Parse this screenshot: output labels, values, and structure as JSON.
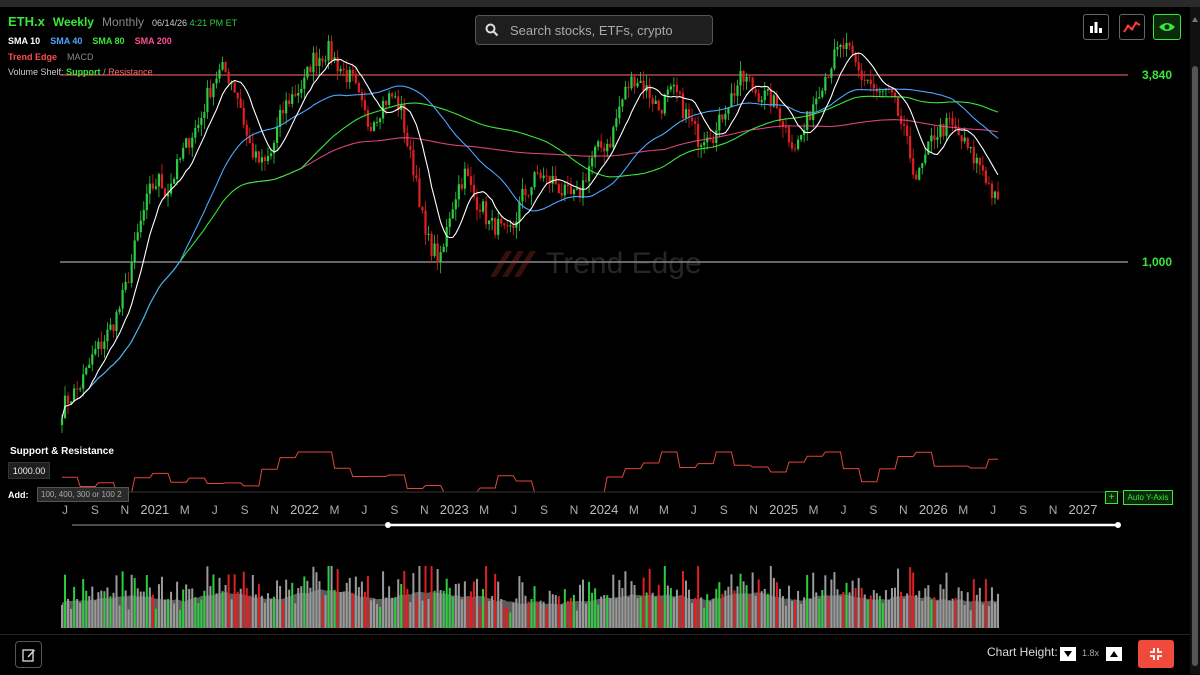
{
  "header": {
    "symbol": "ETH.x",
    "timeframes": [
      "Weekly",
      "Monthly"
    ],
    "active_timeframe": "Weekly",
    "date": "06/14/26",
    "time": "4:21 PM ET"
  },
  "indicators": [
    {
      "label": "SMA 10",
      "color": "#ffffff"
    },
    {
      "label": "SMA 40",
      "color": "#4da6ff"
    },
    {
      "label": "SMA 80",
      "color": "#39e639"
    },
    {
      "label": "SMA 200",
      "color": "#ff4d94"
    }
  ],
  "row2": {
    "trend_edge": "Trend Edge",
    "macd": "MACD"
  },
  "volume_shelf": {
    "label": "Volume Shelf:",
    "support": "Support",
    "sep": "/",
    "resistance": "Resistance"
  },
  "search": {
    "placeholder": "Search stocks, ETFs, crypto"
  },
  "toolbar": [
    {
      "name": "bar-chart-icon"
    },
    {
      "name": "trend-line-icon"
    },
    {
      "name": "eye-icon"
    }
  ],
  "levels": [
    {
      "label": "3,840",
      "value": 3840,
      "color": "#ff6b6b"
    },
    {
      "label": "1,000",
      "value": 1000,
      "color": "#cccccc"
    }
  ],
  "watermark": "Trend Edge",
  "support_resistance": {
    "title": "Support & Resistance",
    "value": "1000.00"
  },
  "add": {
    "label": "Add:",
    "placeholder": "100, 400, 300 or 100 2"
  },
  "x_axis": [
    "J",
    "S",
    "N",
    "2021",
    "M",
    "J",
    "S",
    "N",
    "2022",
    "M",
    "J",
    "S",
    "N",
    "2023",
    "M",
    "J",
    "S",
    "N",
    "2024",
    "M",
    "M",
    "J",
    "S",
    "N",
    "2025",
    "M",
    "J",
    "S",
    "N",
    "2026",
    "M",
    "J",
    "S",
    "N",
    "2027"
  ],
  "buttons": {
    "plus": "+",
    "auto_y": "Auto Y-Axis"
  },
  "chart_height": {
    "label": "Chart Height:",
    "value": "1.8x"
  },
  "colors": {
    "up": "#2ecc40",
    "down": "#e02020",
    "accent": "#39e639",
    "danger": "#f04a3c"
  },
  "chart_data": {
    "type": "candlestick",
    "levels": [
      3840,
      1000
    ],
    "x_range": [
      "2020-07",
      "2027-01"
    ],
    "series": [
      {
        "name": "SMA 10"
      },
      {
        "name": "SMA 40"
      },
      {
        "name": "SMA 80"
      },
      {
        "name": "SMA 200"
      }
    ],
    "approx_weekly_close": [
      350,
      380,
      400,
      450,
      520,
      560,
      620,
      700,
      850,
      1100,
      1400,
      1700,
      1800,
      1650,
      1900,
      2200,
      2500,
      2700,
      3300,
      3800,
      4000,
      3700,
      3200,
      2400,
      2100,
      2000,
      2200,
      2800,
      3200,
      3400,
      3600,
      4300,
      4400,
      4600,
      4200,
      3900,
      3700,
      3100,
      2700,
      2900,
      3200,
      3300,
      3000,
      2200,
      1800,
      1200,
      1100,
      1000,
      1400,
      1700,
      1900,
      1600,
      1500,
      1300,
      1300,
      1200,
      1300,
      1600,
      1700,
      1900,
      1800,
      1800,
      1650,
      1600,
      1600,
      1900,
      2200,
      2300,
      2400,
      3000,
      3500,
      3800,
      3600,
      3300,
      3000,
      3300,
      3400,
      3000,
      2700,
      2400,
      2600,
      2500,
      3000,
      3300,
      3700,
      3700,
      3400,
      3300,
      3200,
      2900,
      2500,
      2300,
      2600,
      3100,
      3600,
      4000,
      4500,
      4700,
      4300,
      3800,
      3700,
      3300,
      3400,
      3200,
      2700,
      2200,
      1800,
      2100,
      2500,
      2600,
      2700,
      2500,
      2300,
      2100,
      2000,
      1700,
      1500
    ]
  }
}
